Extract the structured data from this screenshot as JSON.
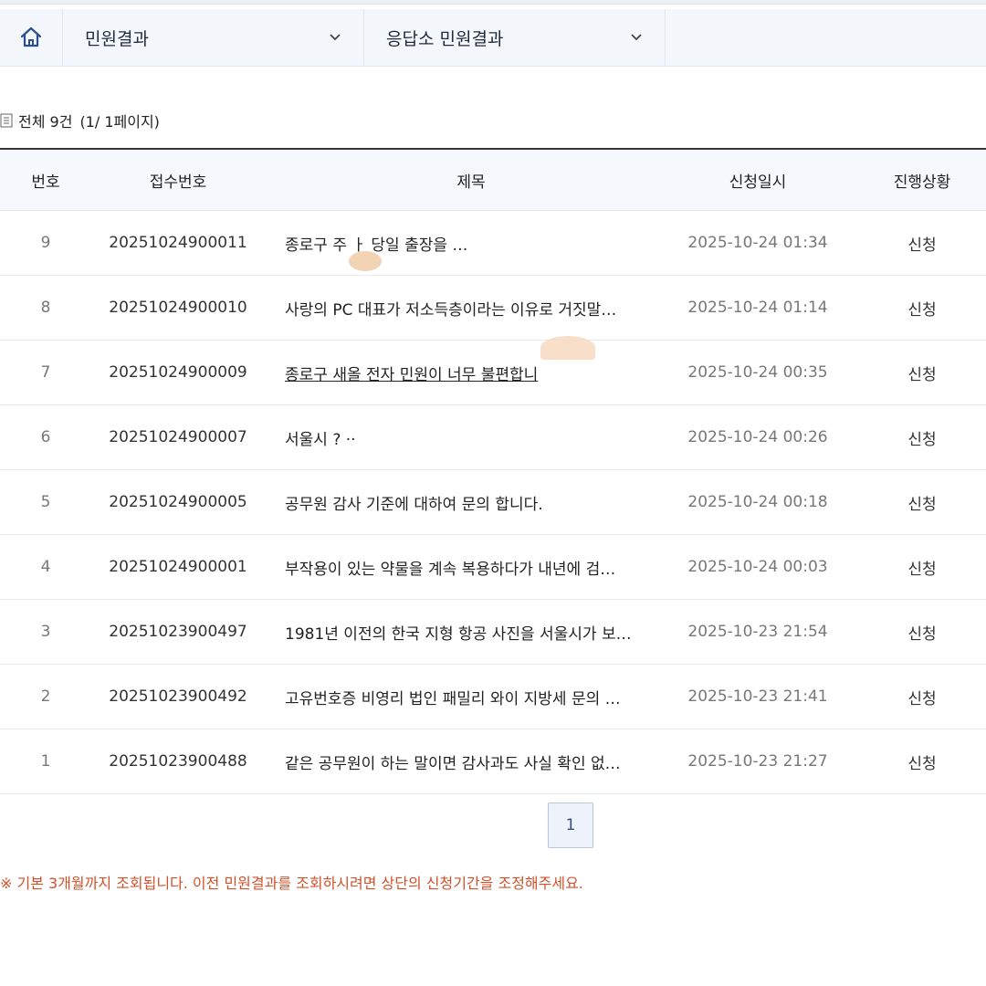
{
  "nav": {
    "home_icon": "home-icon",
    "dropdown1": "민원결과",
    "dropdown2": "응답소 민원결과"
  },
  "summary": {
    "total": "전체 9건",
    "page": "(1/ 1페이지)"
  },
  "table": {
    "headers": {
      "num": "번호",
      "receipt": "접수번호",
      "title": "제목",
      "date": "신청일시",
      "status": "진행상황"
    },
    "rows": [
      {
        "num": "9",
        "receipt": "20251024900011",
        "title": "종로구 주                              ㅏ 당일 출장을 …",
        "date": "2025-10-24 01:34",
        "status": "신청"
      },
      {
        "num": "8",
        "receipt": "20251024900010",
        "title": "사랑의 PC 대표가 저소득층이라는 이유로 거짓말…",
        "date": "2025-10-24 01:14",
        "status": "신청"
      },
      {
        "num": "7",
        "receipt": "20251024900009",
        "title": "종로구 새올 전자 민원이 너무 불편합니",
        "date": "2025-10-24 00:35",
        "status": "신청"
      },
      {
        "num": "6",
        "receipt": "20251024900007",
        "title": "서울시 ?                                           ··",
        "date": "2025-10-24 00:26",
        "status": "신청"
      },
      {
        "num": "5",
        "receipt": "20251024900005",
        "title": "공무원 감사 기준에 대하여 문의 합니다.",
        "date": "2025-10-24 00:18",
        "status": "신청"
      },
      {
        "num": "4",
        "receipt": "20251024900001",
        "title": "부작용이 있는 약물을 계속 복용하다가 내년에 검…",
        "date": "2025-10-24 00:03",
        "status": "신청"
      },
      {
        "num": "3",
        "receipt": "20251023900497",
        "title": "1981년 이전의 한국 지형 항공 사진을 서울시가 보…",
        "date": "2025-10-23 21:54",
        "status": "신청"
      },
      {
        "num": "2",
        "receipt": "20251023900492",
        "title": "고유번호증 비영리 법인 패밀리 와이 지방세 문의 …",
        "date": "2025-10-23 21:41",
        "status": "신청"
      },
      {
        "num": "1",
        "receipt": "20251023900488",
        "title": "같은 공무원이 하는 말이면 감사과도 사실 확인 없…",
        "date": "2025-10-23 21:27",
        "status": "신청"
      }
    ]
  },
  "pager": {
    "current": "1"
  },
  "notice": "※ 기본 3개월까지 조회됩니다. 이전 민원결과를 조회하시려면 상단의 신청기간을 조정해주세요.",
  "colors": {
    "notice": "#d2502a",
    "header_bg": "#f5f8fd",
    "nav_bg": "#f4f8fd",
    "pager_border": "#b9c6dc"
  }
}
